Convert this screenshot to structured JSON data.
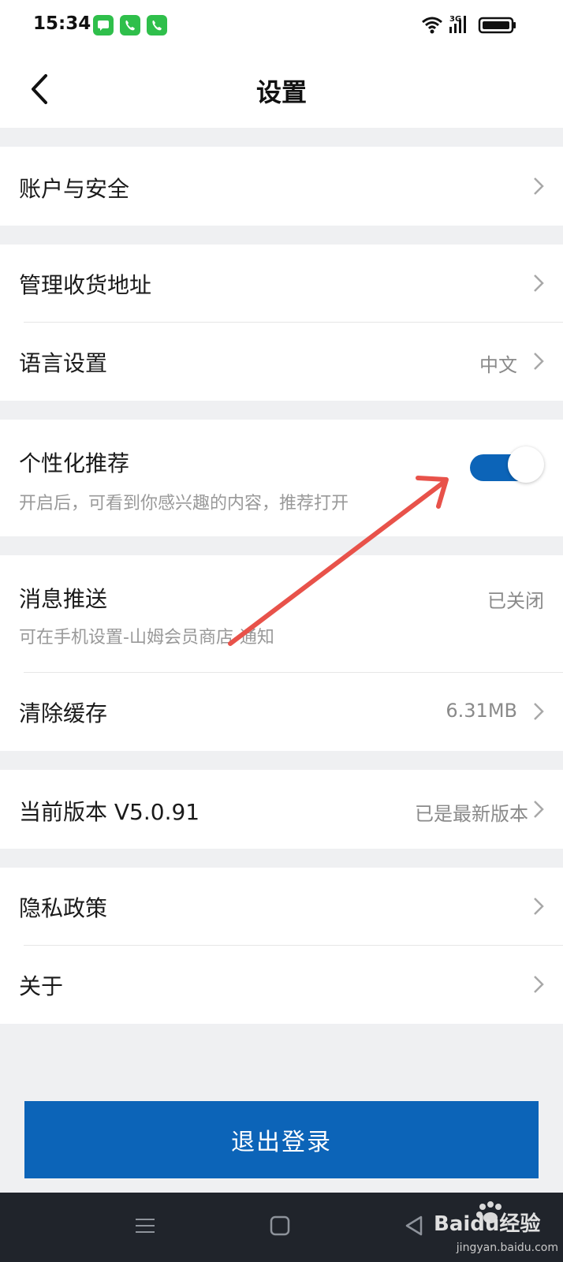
{
  "status_bar": {
    "time": "15:34",
    "notification_icons": [
      "message-icon",
      "phone-icon",
      "phone-icon"
    ],
    "network": "3G"
  },
  "header": {
    "title": "设置"
  },
  "sections": {
    "account_security": {
      "label": "账户与安全"
    },
    "address": {
      "label": "管理收货地址"
    },
    "language": {
      "label": "语言设置",
      "value": "中文"
    },
    "personalized": {
      "label": "个性化推荐",
      "subtitle": "开启后，可看到你感兴趣的内容，推荐打开",
      "toggle_on": true
    },
    "push": {
      "label": "消息推送",
      "subtitle": "可在手机设置-山姆会员商店-通知",
      "value": "已关闭"
    },
    "cache": {
      "label": "清除缓存",
      "value": "6.31MB"
    },
    "version": {
      "label": "当前版本 V5.0.91",
      "value": "已是最新版本"
    },
    "privacy": {
      "label": "隐私政策"
    },
    "about": {
      "label": "关于"
    }
  },
  "logout": {
    "label": "退出登录"
  },
  "colors": {
    "accent": "#0c64b8",
    "background": "#eff0f2",
    "annotation_arrow": "#e8524a",
    "system_nav": "#20242b"
  },
  "watermark": {
    "brand": "Baidu经验",
    "url": "jingyan.baidu.com"
  }
}
